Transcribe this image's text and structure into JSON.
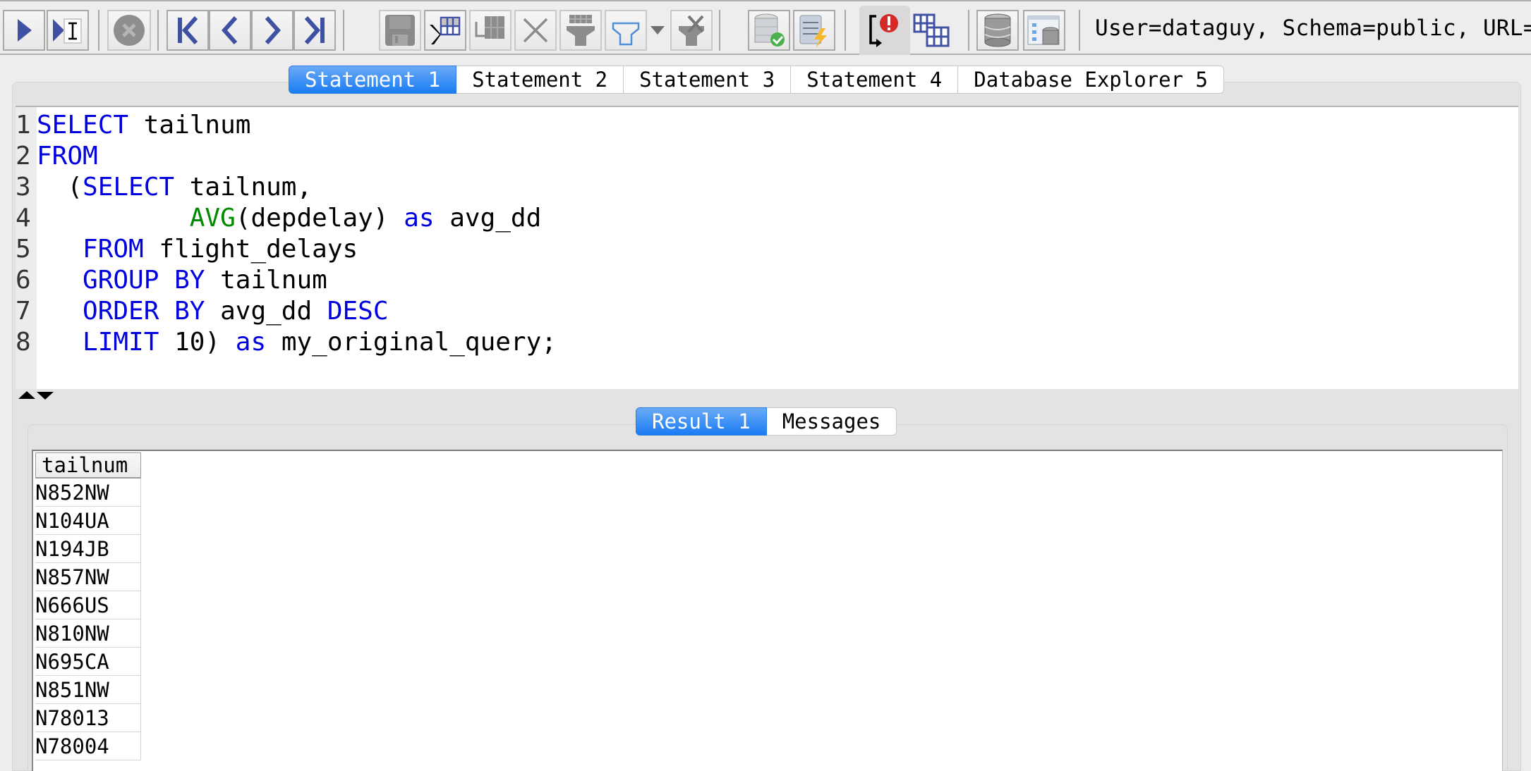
{
  "toolbar": {
    "buttons": [
      {
        "name": "run-statement",
        "icon": "play-icon"
      },
      {
        "name": "run-current-statement",
        "icon": "play-cursor-icon"
      },
      {
        "name": "stop",
        "icon": "stop-icon",
        "disabled": true
      },
      {
        "name": "first-statement",
        "icon": "first-icon"
      },
      {
        "name": "previous-statement",
        "icon": "previous-icon"
      },
      {
        "name": "next-statement",
        "icon": "next-icon"
      },
      {
        "name": "last-statement",
        "icon": "last-icon"
      },
      {
        "name": "save",
        "icon": "save-icon",
        "disabled": true
      },
      {
        "name": "edit-results",
        "icon": "table-cursor-icon"
      },
      {
        "name": "insert-row",
        "icon": "grid-insert-icon",
        "disabled": true
      },
      {
        "name": "delete-row",
        "icon": "delete-x-icon",
        "disabled": true
      },
      {
        "name": "filter-by-grid",
        "icon": "grid-filter-icon",
        "disabled": true
      },
      {
        "name": "filter",
        "icon": "filter-icon"
      },
      {
        "name": "filter-dropdown",
        "icon": "chevron-down-icon"
      },
      {
        "name": "clear-filter",
        "icon": "filter-clear-icon",
        "disabled": true
      },
      {
        "name": "commit",
        "icon": "database-check-icon"
      },
      {
        "name": "rollback",
        "icon": "database-lightning-icon"
      },
      {
        "name": "stop-on-error",
        "icon": "error-toggle-icon",
        "pressed": true
      },
      {
        "name": "append-results",
        "icon": "grid-pair-icon"
      },
      {
        "name": "database",
        "icon": "database-icon"
      },
      {
        "name": "database-explorer",
        "icon": "database-explorer-icon"
      }
    ],
    "connection_info": "User=dataguy, Schema=public, URL=j"
  },
  "statement_tabs": [
    {
      "label": "Statement 1",
      "active": true
    },
    {
      "label": "Statement 2",
      "active": false
    },
    {
      "label": "Statement 3",
      "active": false
    },
    {
      "label": "Statement 4",
      "active": false
    },
    {
      "label": "Database Explorer 5",
      "active": false
    }
  ],
  "editor": {
    "lines": [
      {
        "n": "1",
        "tokens": [
          {
            "t": "SELECT",
            "c": "kw"
          },
          {
            "t": " tailnum",
            "c": ""
          }
        ]
      },
      {
        "n": "2",
        "tokens": [
          {
            "t": "FROM",
            "c": "kw"
          }
        ]
      },
      {
        "n": "3",
        "tokens": [
          {
            "t": "  (",
            "c": ""
          },
          {
            "t": "SELECT",
            "c": "kw"
          },
          {
            "t": " tailnum,",
            "c": ""
          }
        ]
      },
      {
        "n": "4",
        "tokens": [
          {
            "t": "          ",
            "c": ""
          },
          {
            "t": "AVG",
            "c": "fn"
          },
          {
            "t": "(depdelay) ",
            "c": ""
          },
          {
            "t": "as",
            "c": "kw"
          },
          {
            "t": " avg_dd",
            "c": ""
          }
        ]
      },
      {
        "n": "5",
        "tokens": [
          {
            "t": "   ",
            "c": ""
          },
          {
            "t": "FROM",
            "c": "kw"
          },
          {
            "t": " flight_delays",
            "c": ""
          }
        ]
      },
      {
        "n": "6",
        "tokens": [
          {
            "t": "   ",
            "c": ""
          },
          {
            "t": "GROUP BY",
            "c": "kw"
          },
          {
            "t": " tailnum",
            "c": ""
          }
        ]
      },
      {
        "n": "7",
        "tokens": [
          {
            "t": "   ",
            "c": ""
          },
          {
            "t": "ORDER BY",
            "c": "kw"
          },
          {
            "t": " avg_dd ",
            "c": ""
          },
          {
            "t": "DESC",
            "c": "kw"
          }
        ]
      },
      {
        "n": "8",
        "tokens": [
          {
            "t": "   ",
            "c": ""
          },
          {
            "t": "LIMIT",
            "c": "kw"
          },
          {
            "t": " 10) ",
            "c": ""
          },
          {
            "t": "as",
            "c": "kw"
          },
          {
            "t": " my_original_query;",
            "c": ""
          }
        ]
      }
    ]
  },
  "result_tabs": [
    {
      "label": "Result 1",
      "active": true
    },
    {
      "label": "Messages",
      "active": false
    }
  ],
  "result": {
    "columns": [
      "tailnum"
    ],
    "rows": [
      [
        "N852NW"
      ],
      [
        "N104UA"
      ],
      [
        "N194JB"
      ],
      [
        "N857NW"
      ],
      [
        "N666US"
      ],
      [
        "N810NW"
      ],
      [
        "N695CA"
      ],
      [
        "N851NW"
      ],
      [
        "N78013"
      ],
      [
        "N78004"
      ]
    ]
  },
  "colors": {
    "keyword": "#0000e0",
    "function": "#008a00",
    "active_tab": "#1a7cf4",
    "icon_blue": "#3f51a3"
  }
}
